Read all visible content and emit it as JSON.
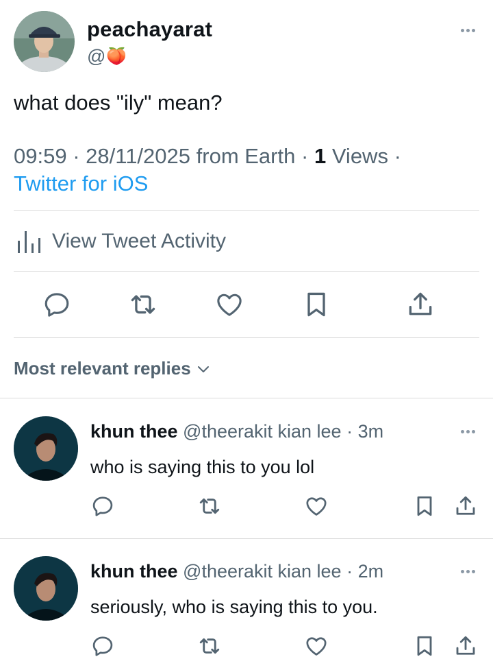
{
  "tweet": {
    "display_name": "peachayarat",
    "handle_prefix": "@",
    "handle_emoji": "🍑",
    "text": "what does \"ily\" mean?",
    "time": "09:59",
    "date": "28/11/2025",
    "location": "from Earth",
    "views_count": "1",
    "views_label": "Views",
    "separator": "·",
    "source": "Twitter for iOS",
    "activity_label": "View Tweet Activity"
  },
  "replies_header": {
    "label": "Most relevant replies"
  },
  "replies": [
    {
      "name": "khun thee",
      "handle": "@theerakit kian lee",
      "time": "3m",
      "text": "who is saying this to you lol"
    },
    {
      "name": "khun thee",
      "handle": "@theerakit kian lee",
      "time": "2m",
      "text": "seriously, who is saying this to you."
    }
  ],
  "colors": {
    "text": "#0f1419",
    "muted": "#536471",
    "link": "#1d9bf0",
    "divider": "#dadada"
  },
  "icons": [
    "reply-icon",
    "retweet-icon",
    "like-icon",
    "bookmark-icon",
    "share-icon",
    "chart-icon",
    "more-icon",
    "chevron-down-icon"
  ]
}
